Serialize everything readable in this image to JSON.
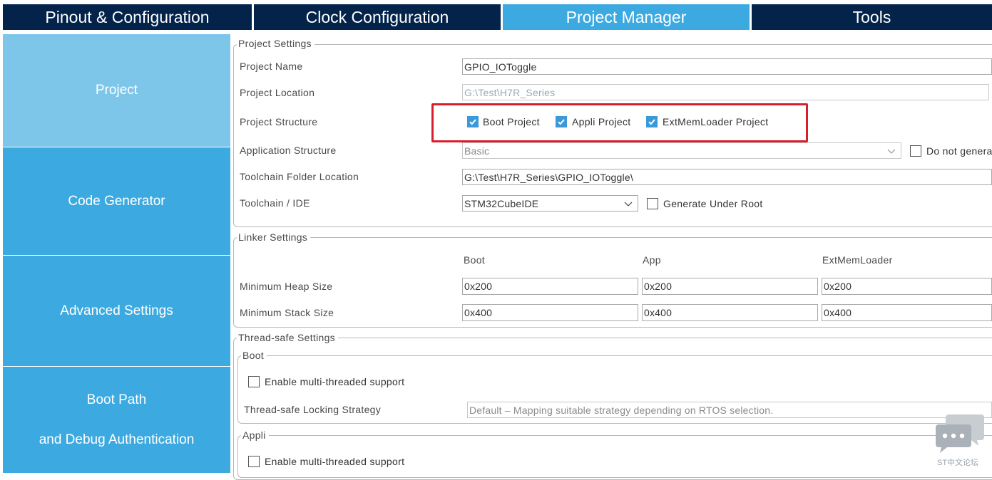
{
  "tabs": [
    {
      "label": "Pinout & Configuration"
    },
    {
      "label": "Clock Configuration"
    },
    {
      "label": "Project Manager"
    },
    {
      "label": "Tools"
    }
  ],
  "sidebar": {
    "items": [
      {
        "label": "Project"
      },
      {
        "label": "Code Generator"
      },
      {
        "label": "Advanced Settings"
      },
      {
        "label_line1": "Boot Path",
        "label_line2": "and Debug Authentication"
      }
    ]
  },
  "project_settings": {
    "legend": "Project Settings",
    "name_label": "Project Name",
    "name_value": "GPIO_IOToggle",
    "location_label": "Project Location",
    "location_value": "G:\\Test\\H7R_Series",
    "structure_label": "Project Structure",
    "structure_options": [
      {
        "label": "Boot Project",
        "checked": true
      },
      {
        "label": "Appli Project",
        "checked": true
      },
      {
        "label": "ExtMemLoader Project",
        "checked": true
      }
    ],
    "app_structure_label": "Application Structure",
    "app_structure_value": "Basic",
    "do_not_generate_label": "Do not genera",
    "toolchain_folder_label": "Toolchain Folder Location",
    "toolchain_folder_value": "G:\\Test\\H7R_Series\\GPIO_IOToggle\\",
    "toolchain_ide_label": "Toolchain / IDE",
    "toolchain_ide_value": "STM32CubeIDE",
    "generate_under_root_label": "Generate Under Root"
  },
  "linker_settings": {
    "legend": "Linker Settings",
    "columns": [
      "Boot",
      "App",
      "ExtMemLoader"
    ],
    "heap_label": "Minimum Heap Size",
    "heap_values": [
      "0x200",
      "0x200",
      "0x200"
    ],
    "stack_label": "Minimum Stack Size",
    "stack_values": [
      "0x400",
      "0x400",
      "0x400"
    ]
  },
  "thread_safe": {
    "legend": "Thread-safe Settings",
    "boot": {
      "legend": "Boot",
      "enable_label": "Enable multi-threaded support",
      "strategy_label": "Thread-safe Locking Strategy",
      "strategy_value": "Default – Mapping suitable strategy depending on RTOS selection."
    },
    "appli": {
      "legend": "Appli",
      "enable_label": "Enable multi-threaded support"
    }
  },
  "watermark": {
    "text": "ST中文论坛"
  },
  "colors": {
    "dark_tab": "#03234b",
    "accent": "#3caae0",
    "active_side": "#7dc6ea",
    "highlight": "#d91e2b"
  }
}
